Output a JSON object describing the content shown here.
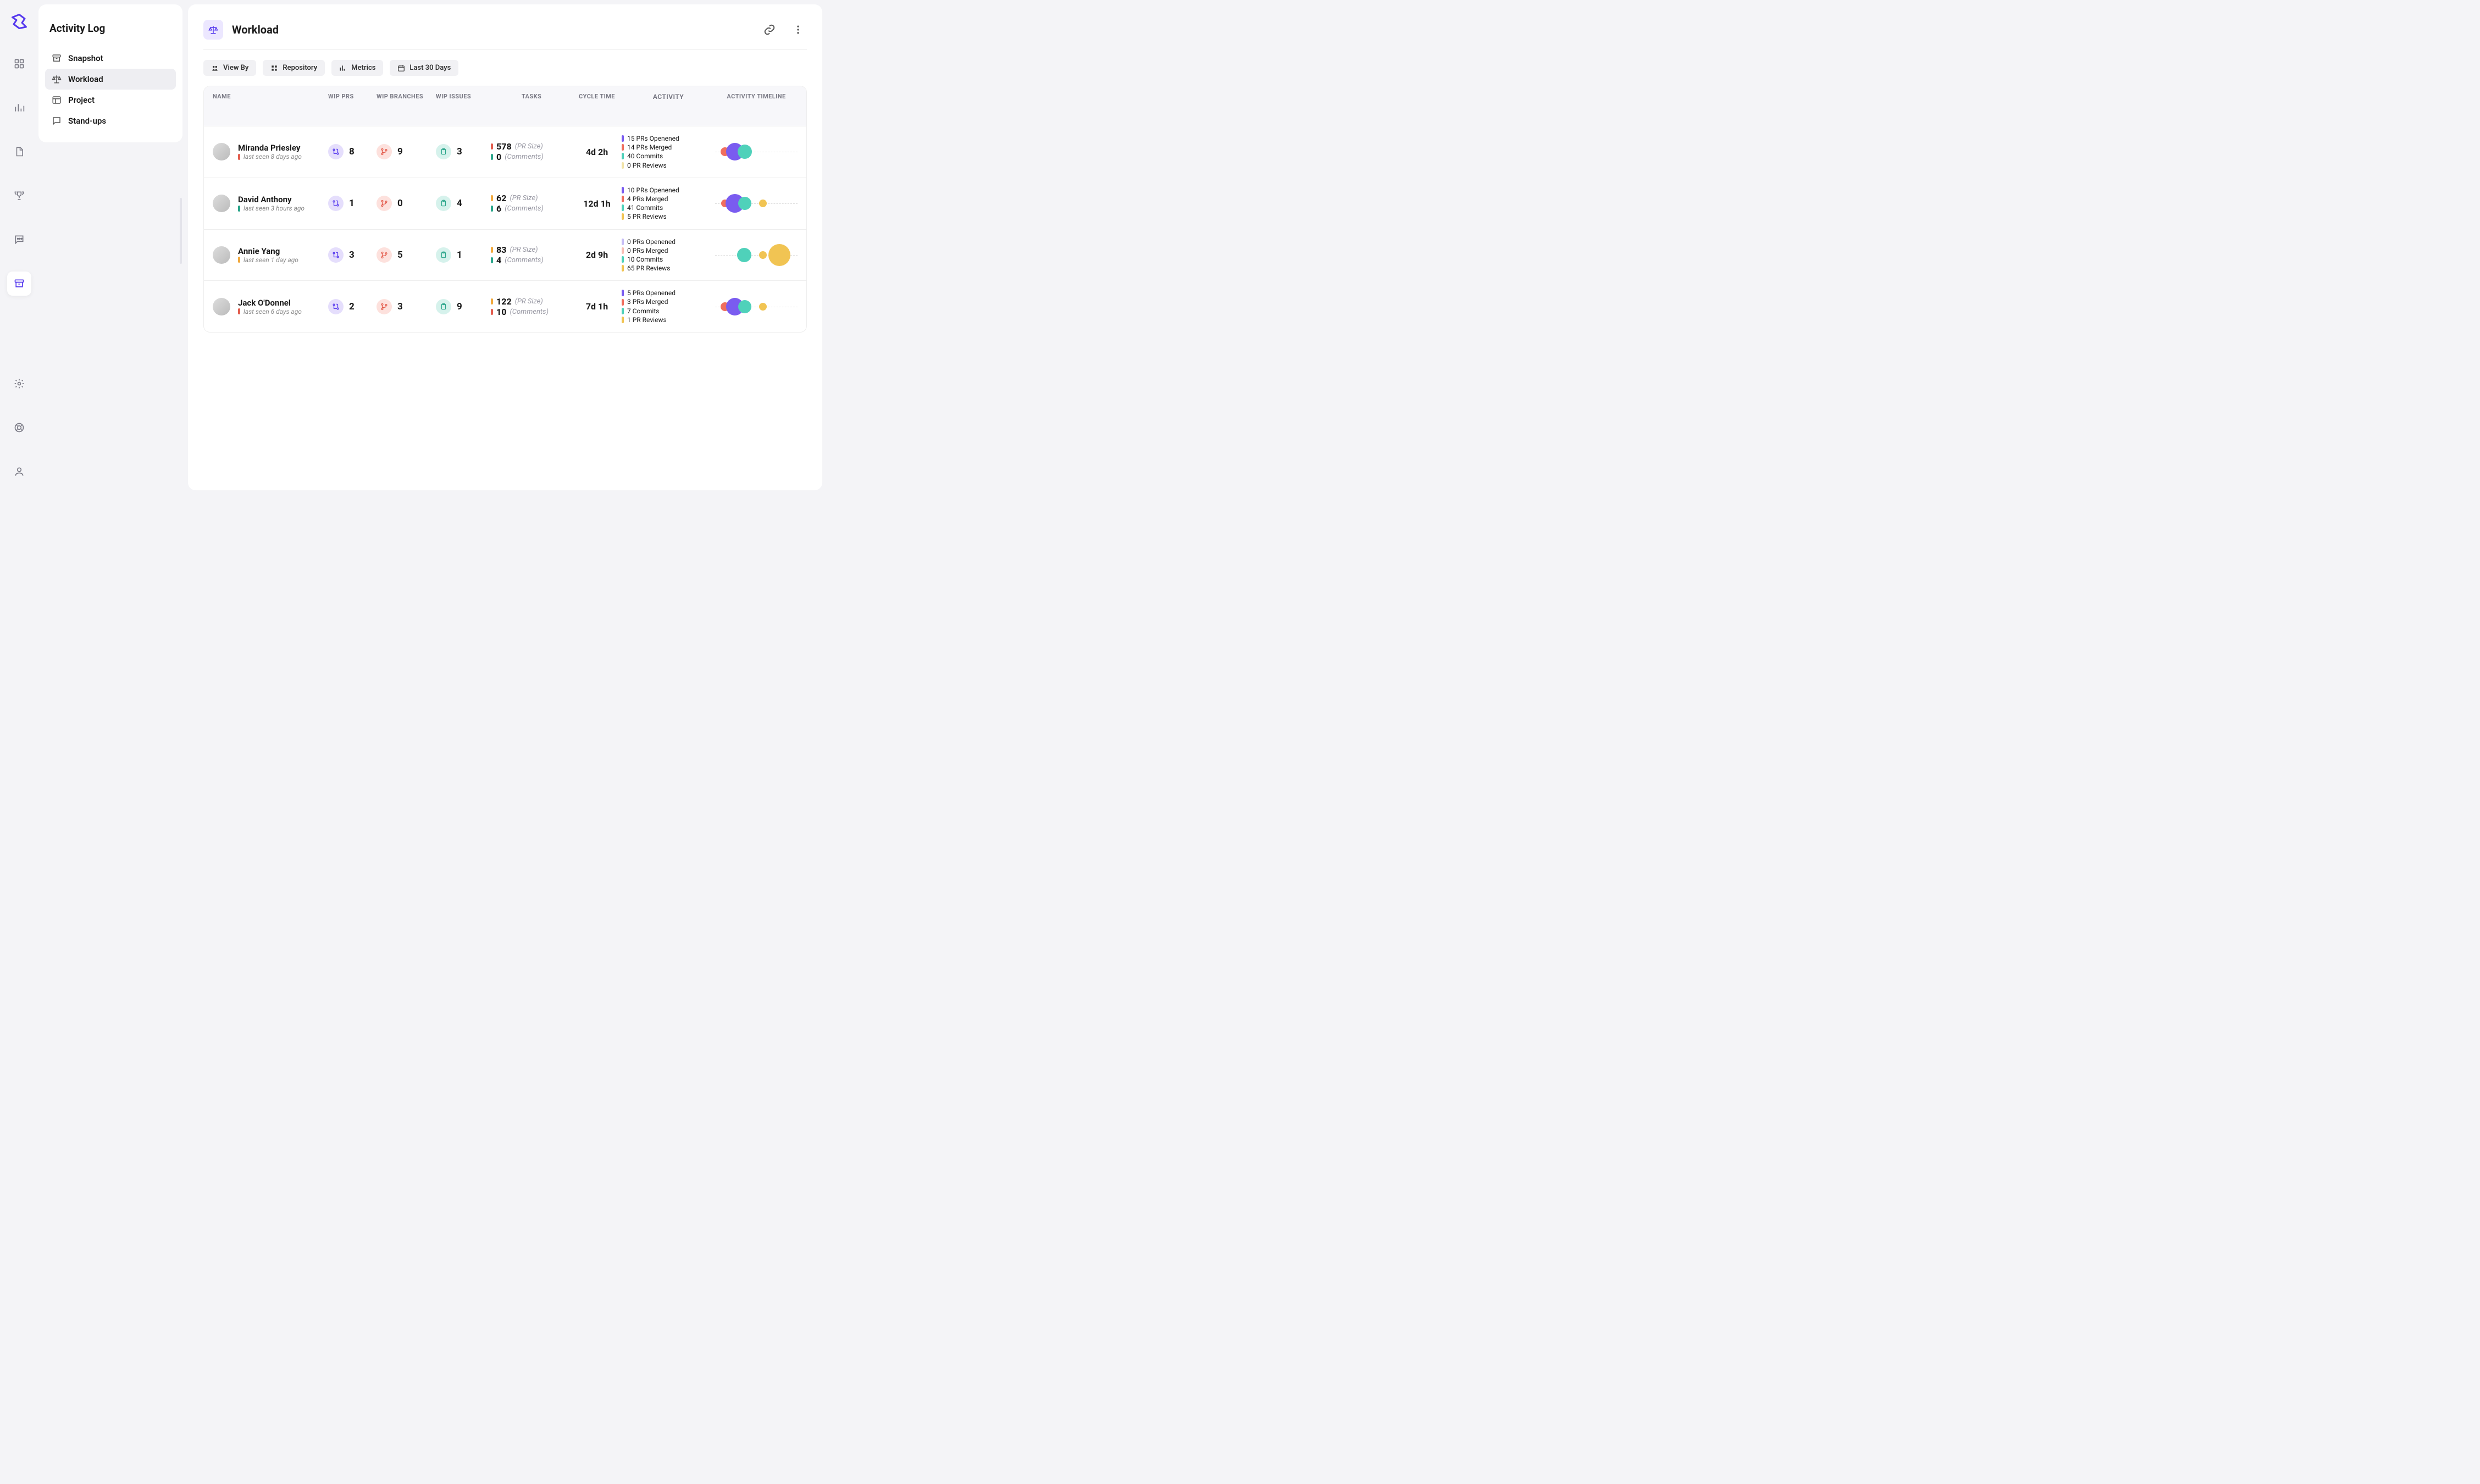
{
  "sidebar": {
    "title": "Activity Log",
    "items": [
      {
        "label": "Snapshot",
        "icon": "archive"
      },
      {
        "label": "Workload",
        "icon": "scale",
        "active": true
      },
      {
        "label": "Project",
        "icon": "layout"
      },
      {
        "label": "Stand-ups",
        "icon": "chat"
      }
    ]
  },
  "page": {
    "title": "Workload"
  },
  "filters": {
    "view_by": "View By",
    "repository": "Repository",
    "metrics": "Metrics",
    "date_range": "Last 30 Days"
  },
  "columns": {
    "name": "Name",
    "wip_prs": "WIP PRs",
    "wip_branches": "WIP Branches",
    "wip_issues": "WIP Issues",
    "tasks": "Tasks",
    "cycle_time": "Cycle Time",
    "activity": "Activity",
    "timeline": "Activity Timeline"
  },
  "colors": {
    "violet": "#7a5cf0",
    "coral": "#f06e5e",
    "teal": "#4fd1ba",
    "gold": "#f1c453",
    "green": "#2aa58a",
    "red": "#e35d4e",
    "amber": "#f1a93d"
  },
  "rows": [
    {
      "name": "Miranda Priesley",
      "last_seen": "last seen 8 days ago",
      "status_color": "#e35d4e",
      "wip_prs": "8",
      "wip_branches": "9",
      "wip_issues": "3",
      "pr_size": "578",
      "pr_size_label": "(PR Size)",
      "pr_size_color": "#e35d4e",
      "comments": "0",
      "comments_label": "(Comments)",
      "comments_color": "#2aa58a",
      "cycle_time": "4d 2h",
      "activity": [
        {
          "color": "#7a5cf0",
          "text": "15 PRs Openened"
        },
        {
          "color": "#f06e5e",
          "text": "14 PRs Merged"
        },
        {
          "color": "#4fd1ba",
          "text": "40 Commits"
        },
        {
          "color": "#f1e3a8",
          "text": "0 PR Reviews"
        }
      ],
      "bubbles": [
        {
          "x": 12,
          "size": 16,
          "class": "c-coral"
        },
        {
          "x": 24,
          "size": 32,
          "class": "c-violet"
        },
        {
          "x": 36,
          "size": 26,
          "class": "c-teal"
        }
      ]
    },
    {
      "name": "David Anthony",
      "last_seen": "last seen 3 hours ago",
      "status_color": "#2aa58a",
      "wip_prs": "1",
      "wip_branches": "0",
      "wip_issues": "4",
      "pr_size": "62",
      "pr_size_label": "(PR Size)",
      "pr_size_color": "#f1a93d",
      "comments": "6",
      "comments_label": "(Comments)",
      "comments_color": "#2aa58a",
      "cycle_time": "12d 1h",
      "activity": [
        {
          "color": "#7a5cf0",
          "text": "10 PRs Openened"
        },
        {
          "color": "#f06e5e",
          "text": "4 PRs Merged"
        },
        {
          "color": "#4fd1ba",
          "text": "41 Commits"
        },
        {
          "color": "#f1c453",
          "text": "5 PR Reviews"
        }
      ],
      "bubbles": [
        {
          "x": 12,
          "size": 14,
          "class": "c-coral"
        },
        {
          "x": 24,
          "size": 34,
          "class": "c-violet"
        },
        {
          "x": 36,
          "size": 24,
          "class": "c-teal"
        },
        {
          "x": 58,
          "size": 14,
          "class": "c-gold"
        }
      ]
    },
    {
      "name": "Annie Yang",
      "last_seen": "last seen 1 day ago",
      "status_color": "#f1a93d",
      "wip_prs": "3",
      "wip_branches": "5",
      "wip_issues": "1",
      "pr_size": "83",
      "pr_size_label": "(PR Size)",
      "pr_size_color": "#f1a93d",
      "comments": "4",
      "comments_label": "(Comments)",
      "comments_color": "#2aa58a",
      "cycle_time": "2d 9h",
      "activity": [
        {
          "color": "#c7bdf5",
          "text": "0 PRs Openened"
        },
        {
          "color": "#f8bdb4",
          "text": "0 PRs Merged"
        },
        {
          "color": "#4fd1ba",
          "text": "10 Commits"
        },
        {
          "color": "#f1c453",
          "text": "65 PR Reviews"
        }
      ],
      "bubbles": [
        {
          "x": 35,
          "size": 26,
          "class": "c-teal"
        },
        {
          "x": 58,
          "size": 14,
          "class": "c-gold"
        },
        {
          "x": 78,
          "size": 40,
          "class": "c-gold"
        }
      ]
    },
    {
      "name": "Jack O'Donnel",
      "last_seen": "last seen 6 days ago",
      "status_color": "#e35d4e",
      "wip_prs": "2",
      "wip_branches": "3",
      "wip_issues": "9",
      "pr_size": "122",
      "pr_size_label": "(PR Size)",
      "pr_size_color": "#f1a93d",
      "comments": "10",
      "comments_label": "(Comments)",
      "comments_color": "#e35d4e",
      "cycle_time": "7d 1h",
      "activity": [
        {
          "color": "#7a5cf0",
          "text": "5 PRs Openened"
        },
        {
          "color": "#f06e5e",
          "text": "3 PRs Merged"
        },
        {
          "color": "#4fd1ba",
          "text": "7 Commits"
        },
        {
          "color": "#f1c453",
          "text": "1 PR Reviews"
        }
      ],
      "bubbles": [
        {
          "x": 12,
          "size": 16,
          "class": "c-coral"
        },
        {
          "x": 24,
          "size": 32,
          "class": "c-violet"
        },
        {
          "x": 36,
          "size": 24,
          "class": "c-teal"
        },
        {
          "x": 58,
          "size": 14,
          "class": "c-gold"
        }
      ]
    }
  ]
}
